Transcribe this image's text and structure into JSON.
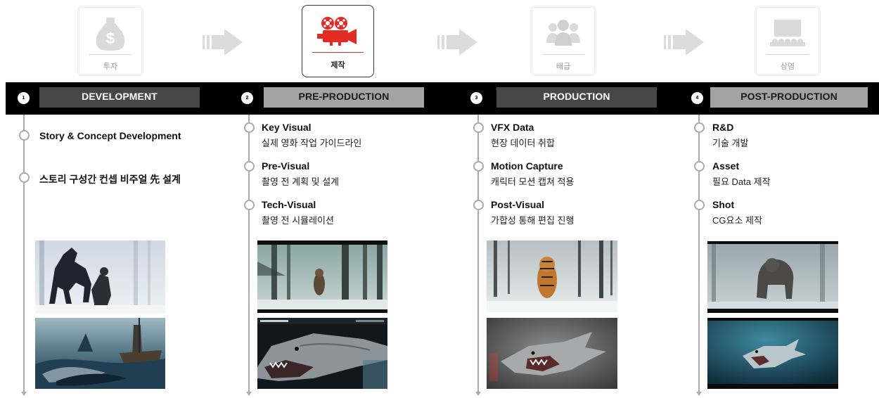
{
  "stages": [
    {
      "label": "투자",
      "icon": "money-bag-icon"
    },
    {
      "label": "제작",
      "icon": "film-camera-icon",
      "active": true
    },
    {
      "label": "배급",
      "icon": "people-group-icon"
    },
    {
      "label": "상영",
      "icon": "cinema-screen-icon"
    }
  ],
  "phases": [
    {
      "number": "1",
      "title": "DEVELOPMENT"
    },
    {
      "number": "2",
      "title": "PRE-PRODUCTION"
    },
    {
      "number": "3",
      "title": "PRODUCTION"
    },
    {
      "number": "4",
      "title": "POST-PRODUCTION"
    }
  ],
  "development": {
    "items": [
      {
        "title": "Story & Concept Development"
      },
      {
        "title": "스토리 구성간 컨셉 비주얼 先 설계"
      }
    ]
  },
  "preproduction": {
    "items": [
      {
        "title": "Key Visual",
        "desc": "실제 영화 작업 가이드라인"
      },
      {
        "title": "Pre-Visual",
        "desc": "촬영 전 계획 및 설계"
      },
      {
        "title": "Tech-Visual",
        "desc": "촬영 전 시뮬레이션"
      }
    ]
  },
  "production": {
    "items": [
      {
        "title": "VFX Data",
        "desc": "현장 데이터 취합"
      },
      {
        "title": "Motion Capture",
        "desc": "캐릭터 모션 캡쳐 적용"
      },
      {
        "title": "Post-Visual",
        "desc": "가합성 통해 편집 진행"
      }
    ]
  },
  "postproduction": {
    "items": [
      {
        "title": "R&D",
        "desc": "기술 개발"
      },
      {
        "title": "Asset",
        "desc": "필요 Data 제작"
      },
      {
        "title": "Shot",
        "desc": "CG요소 제작"
      }
    ]
  },
  "colors": {
    "accent": "#e32b24",
    "band": "#000000",
    "timeline": "#aaaaaa",
    "phase_dark": "#474747",
    "phase_light": "#a3a3a3"
  }
}
